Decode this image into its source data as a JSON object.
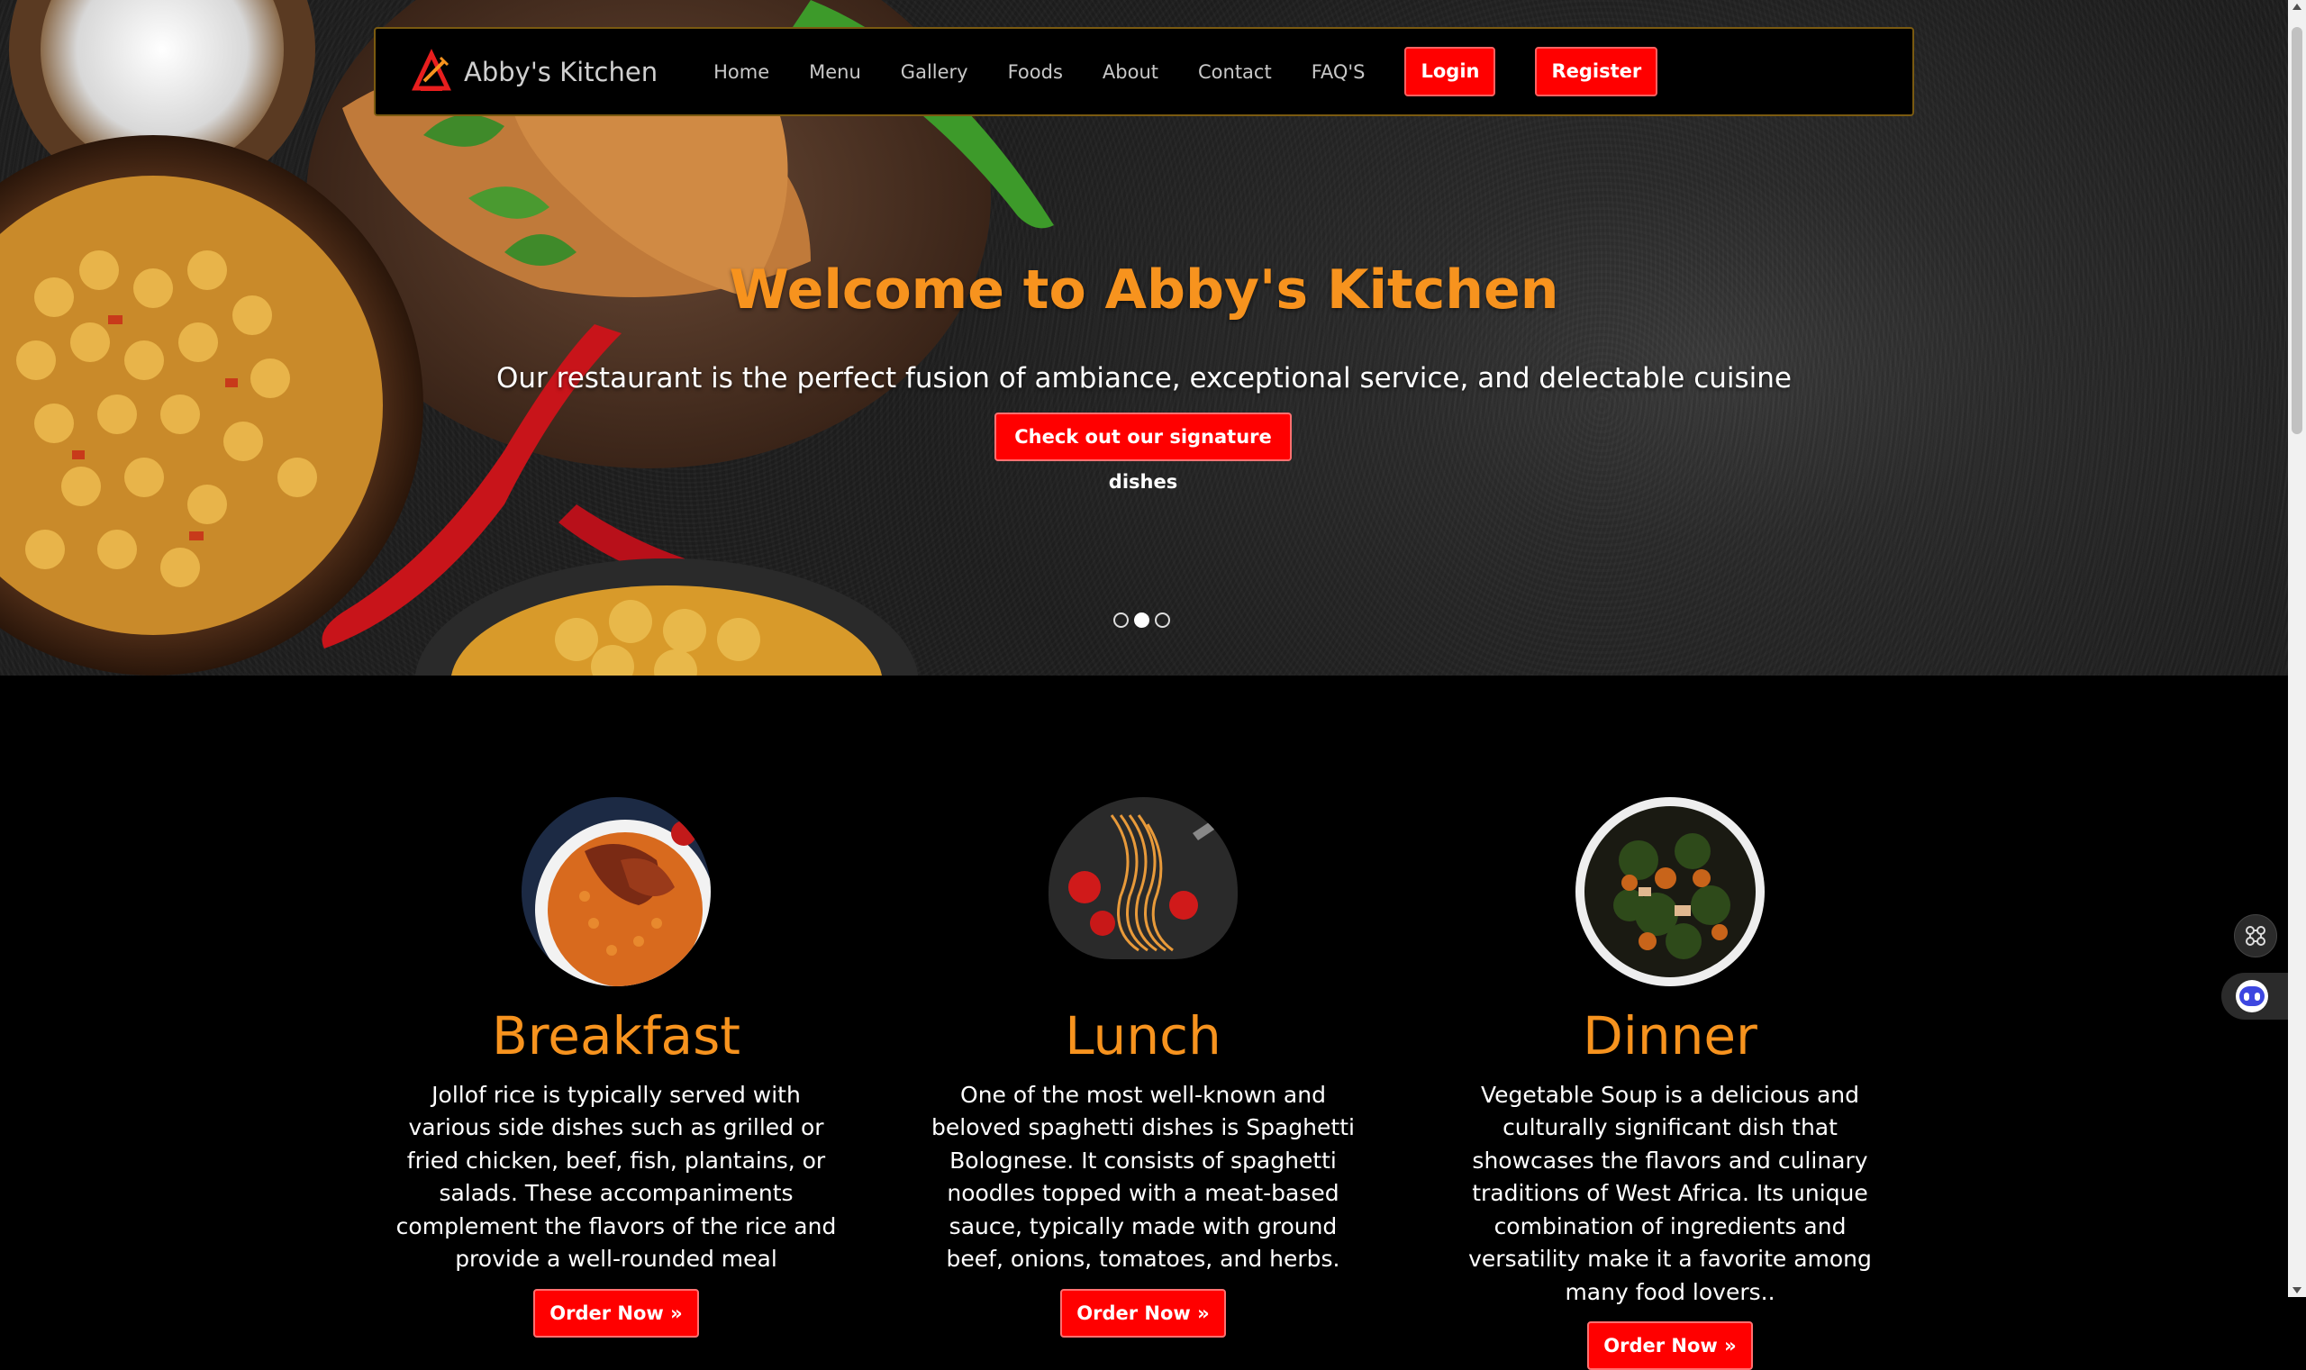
{
  "nav": {
    "brand": "Abby's Kitchen",
    "links": [
      "Home",
      "Menu",
      "Gallery",
      "Foods",
      "About",
      "Contact",
      "FAQ'S"
    ],
    "login_label": "Login",
    "register_label": "Register"
  },
  "hero": {
    "title": "Welcome to Abby's Kitchen",
    "subtitle": "Our restaurant is the perfect fusion of ambiance, exceptional service, and delectable cuisine",
    "cta_label": "Check out our signature dishes",
    "carousel": {
      "slides": 3,
      "active": 1
    }
  },
  "meals": [
    {
      "title": "Breakfast",
      "description": "Jollof rice is typically served with various side dishes such as grilled or fried chicken, beef, fish, plantains, or salads. These accompaniments complement the flavors of the rice and provide a well-rounded meal",
      "button": "Order Now »"
    },
    {
      "title": "Lunch",
      "description": "One of the most well-known and beloved spaghetti dishes is Spaghetti Bolognese. It consists of spaghetti noodles topped with a meat-based sauce, typically made with ground beef, onions, tomatoes, and herbs.",
      "button": "Order Now »"
    },
    {
      "title": "Dinner",
      "description": "Vegetable Soup is a delicious and culturally significant dish that showcases the flavors and culinary traditions of West Africa. Its unique combination of ingredients and versatility make it a favorite among many food lovers..",
      "button": "Order Now »"
    }
  ],
  "colors": {
    "accent_orange": "#f7931e",
    "button_red": "#ff0000",
    "nav_border": "#7a5a10"
  },
  "icons": {
    "floating_widget": "command-icon",
    "floating_bot": "bot-icon"
  }
}
